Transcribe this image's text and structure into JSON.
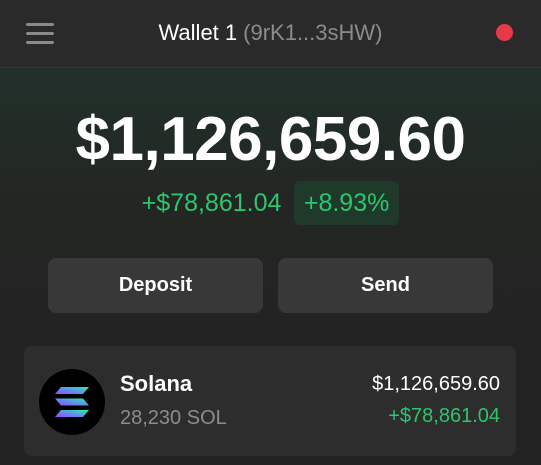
{
  "header": {
    "menu_icon": "hamburger-menu-icon",
    "wallet_name": "Wallet 1",
    "wallet_address": "(9rK1...3sHW)",
    "status_dot_color": "#e63a47"
  },
  "balance": {
    "total": "$1,126,659.60",
    "change_amount": "+$78,861.04",
    "change_percent": "+8.93%",
    "positive_color": "#2ec56f"
  },
  "actions": {
    "deposit_label": "Deposit",
    "send_label": "Send"
  },
  "tokens": [
    {
      "icon": "solana-logo-icon",
      "name": "Solana",
      "amount": "28,230 SOL",
      "value": "$1,126,659.60",
      "change": "+$78,861.04"
    }
  ]
}
